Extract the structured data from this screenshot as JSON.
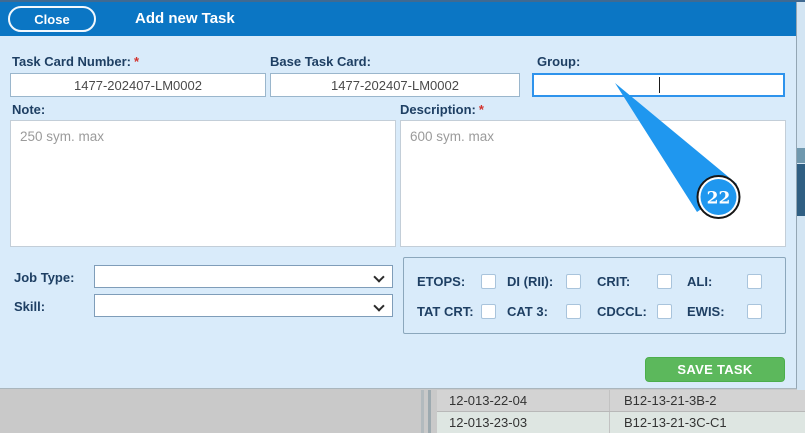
{
  "header": {
    "close_label": "Close",
    "title": "Add new Task"
  },
  "misc": {
    "required_marker": "*"
  },
  "colors": {
    "header_blue": "#0b76c4",
    "body_light_blue": "#d9ebfa",
    "focus_border": "#2e93ec",
    "save_green": "#5cb85c",
    "annotation_blue": "#1f97ef",
    "label_navy": "#1e3f63",
    "required_red": "#d2322d"
  },
  "form": {
    "task_card_number": {
      "label": "Task Card Number:",
      "required": true,
      "value": "1477-202407-LM0002"
    },
    "base_task_card": {
      "label": "Base Task Card:",
      "required": false,
      "value": "1477-202407-LM0002"
    },
    "group": {
      "label": "Group:",
      "value": "",
      "focused": true
    },
    "note": {
      "label": "Note:",
      "placeholder": "250 sym. max",
      "value": ""
    },
    "description": {
      "label": "Description:",
      "required": true,
      "placeholder": "600 sym. max",
      "value": ""
    },
    "job_type": {
      "label": "Job Type:",
      "selected": ""
    },
    "skill": {
      "label": "Skill:",
      "selected": ""
    },
    "checkboxes": [
      {
        "label": "ETOPS:",
        "checked": false
      },
      {
        "label": "DI (RII):",
        "checked": false
      },
      {
        "label": "CRIT:",
        "checked": false
      },
      {
        "label": "ALI:",
        "checked": false
      },
      {
        "label": "TAT CRT:",
        "checked": false
      },
      {
        "label": "CAT 3:",
        "checked": false
      },
      {
        "label": "CDCCL:",
        "checked": false
      },
      {
        "label": "EWIS:",
        "checked": false
      }
    ],
    "save_button": "SAVE TASK"
  },
  "annotation": {
    "step_number": "22"
  },
  "background_table": {
    "rows": [
      [
        "12-013-22-04",
        "B12-13-21-3B-2"
      ],
      [
        "12-013-23-03",
        "B12-13-21-3C-C1"
      ]
    ]
  }
}
